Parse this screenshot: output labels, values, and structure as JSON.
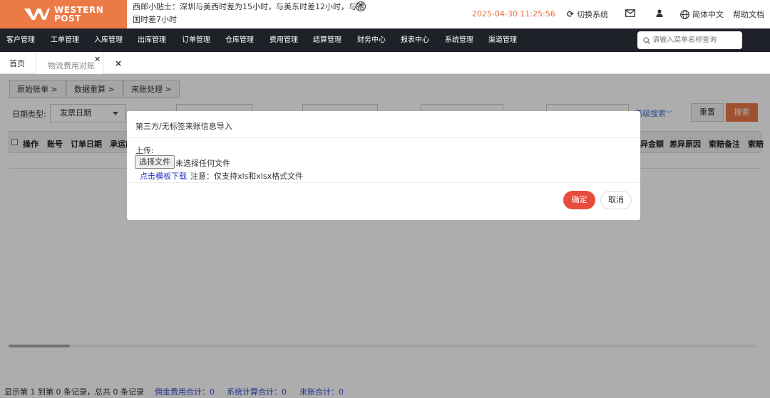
{
  "header": {
    "logo_line1": "WESTERN",
    "logo_line2": "POST",
    "tip": "西邮小贴士：深圳与美西时差为15小时，与美东时差12小时，与德国时差7小时",
    "datetime": "2025-04-30 11:25:56",
    "switch_system": "切换系统",
    "language": "简体中文",
    "help": "帮助文档"
  },
  "nav": {
    "items": [
      "客户管理",
      "工单管理",
      "入库管理",
      "出库管理",
      "订单管理",
      "仓库管理",
      "费用管理",
      "结算管理",
      "财务中心",
      "报表中心",
      "系统管理",
      "渠道管理"
    ],
    "search_placeholder": "请输入菜单名称查询"
  },
  "tabs": {
    "home": "首页",
    "active": "物流费用对账"
  },
  "breadcrumbs": [
    "原始账单 >",
    "数据重算 >",
    "来账处理 >"
  ],
  "filters": {
    "date_type_label": "日期类型:",
    "date_type_value": "发票日期",
    "advanced": "高级搜索",
    "reset": "重置",
    "search": "搜索"
  },
  "table": {
    "headers_left": [
      "操作",
      "账号",
      "订单日期",
      "承运商"
    ],
    "headers_right": [
      "差异金额",
      "差异原因",
      "索赔备注",
      "索赔"
    ]
  },
  "footer": {
    "records": "显示第 1 到第 0 条记录，总共 0 条记录",
    "commission": "佣金费用合计：0",
    "system_calc": "系统计算合计：0",
    "incoming": "来账合计：0"
  },
  "modal": {
    "title": "第三方/无标签来账信息导入",
    "upload_label": "上传:",
    "file_button": "选择文件",
    "file_status": "未选择任何文件",
    "template_link": "点击模板下载",
    "note": "注意：仅支持xls和xlsx格式文件",
    "ok": "确定",
    "cancel": "取消"
  }
}
